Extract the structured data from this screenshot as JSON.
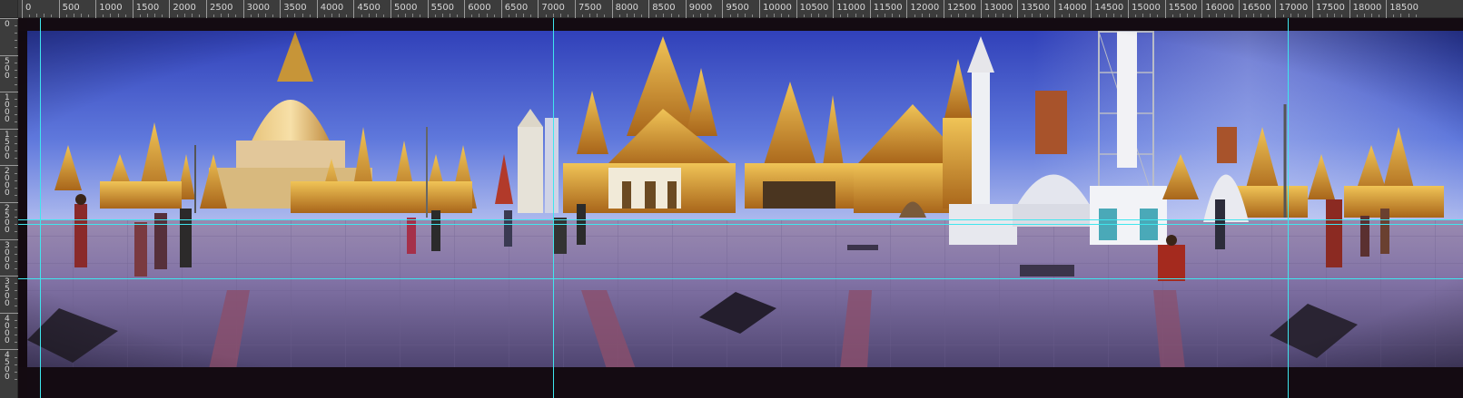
{
  "ruler_top": {
    "labels": [
      "0",
      "500",
      "1000",
      "1500",
      "2000",
      "2500",
      "3000",
      "3500",
      "4000",
      "4500",
      "5000",
      "5500",
      "6000",
      "6500",
      "7000",
      "7500",
      "8000",
      "8500",
      "9000",
      "9500",
      "10000",
      "10500",
      "11000",
      "11500",
      "12000",
      "12500",
      "13000",
      "13500",
      "14000",
      "14500",
      "15000",
      "15500",
      "16000",
      "16500",
      "17000",
      "17500",
      "18000",
      "18500"
    ]
  },
  "ruler_left": {
    "labels": [
      "0",
      "500",
      "1000",
      "1500",
      "2000",
      "2500",
      "3000",
      "3500",
      "4000",
      "4500"
    ]
  },
  "canvas": {
    "image_name": "panorama-image",
    "colors": {
      "sky_top": "#3a48c8",
      "sky_bottom": "#a9b7ee",
      "gold": "#d49a2a",
      "plaza": "#7d6fa0",
      "guide": "#3fe6ee"
    }
  },
  "guides": {
    "vertical_count": 3,
    "horizontal_count": 3
  }
}
